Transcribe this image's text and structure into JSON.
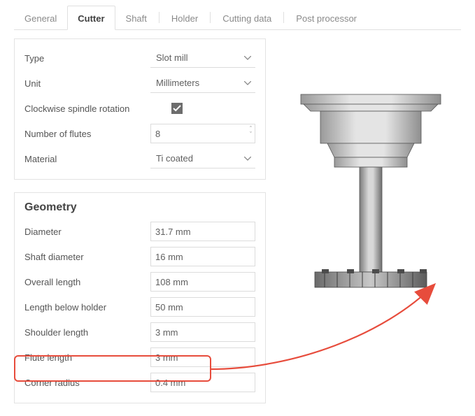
{
  "tabs": {
    "items": [
      {
        "label": "General"
      },
      {
        "label": "Cutter"
      },
      {
        "label": "Shaft"
      },
      {
        "label": "Holder"
      },
      {
        "label": "Cutting data"
      },
      {
        "label": "Post processor"
      }
    ],
    "active_index": 1
  },
  "basic": {
    "type_label": "Type",
    "type_value": "Slot mill",
    "unit_label": "Unit",
    "unit_value": "Millimeters",
    "cw_label": "Clockwise spindle rotation",
    "cw_checked": true,
    "flutes_label": "Number of flutes",
    "flutes_value": "8",
    "material_label": "Material",
    "material_value": "Ti coated"
  },
  "geometry": {
    "heading": "Geometry",
    "diameter_label": "Diameter",
    "diameter_value": "31.7 mm",
    "shaftdia_label": "Shaft diameter",
    "shaftdia_value": "16 mm",
    "overall_label": "Overall length",
    "overall_value": "108 mm",
    "below_label": "Length below holder",
    "below_value": "50 mm",
    "shoulder_label": "Shoulder length",
    "shoulder_value": "3 mm",
    "flutelen_label": "Flute length",
    "flutelen_value": "3 mm",
    "corner_label": "Corner radius",
    "corner_value": "0.4 mm"
  },
  "annotation": {
    "highlighted_field": "corner_radius",
    "arrow_target": "tool_cutter_edge"
  }
}
